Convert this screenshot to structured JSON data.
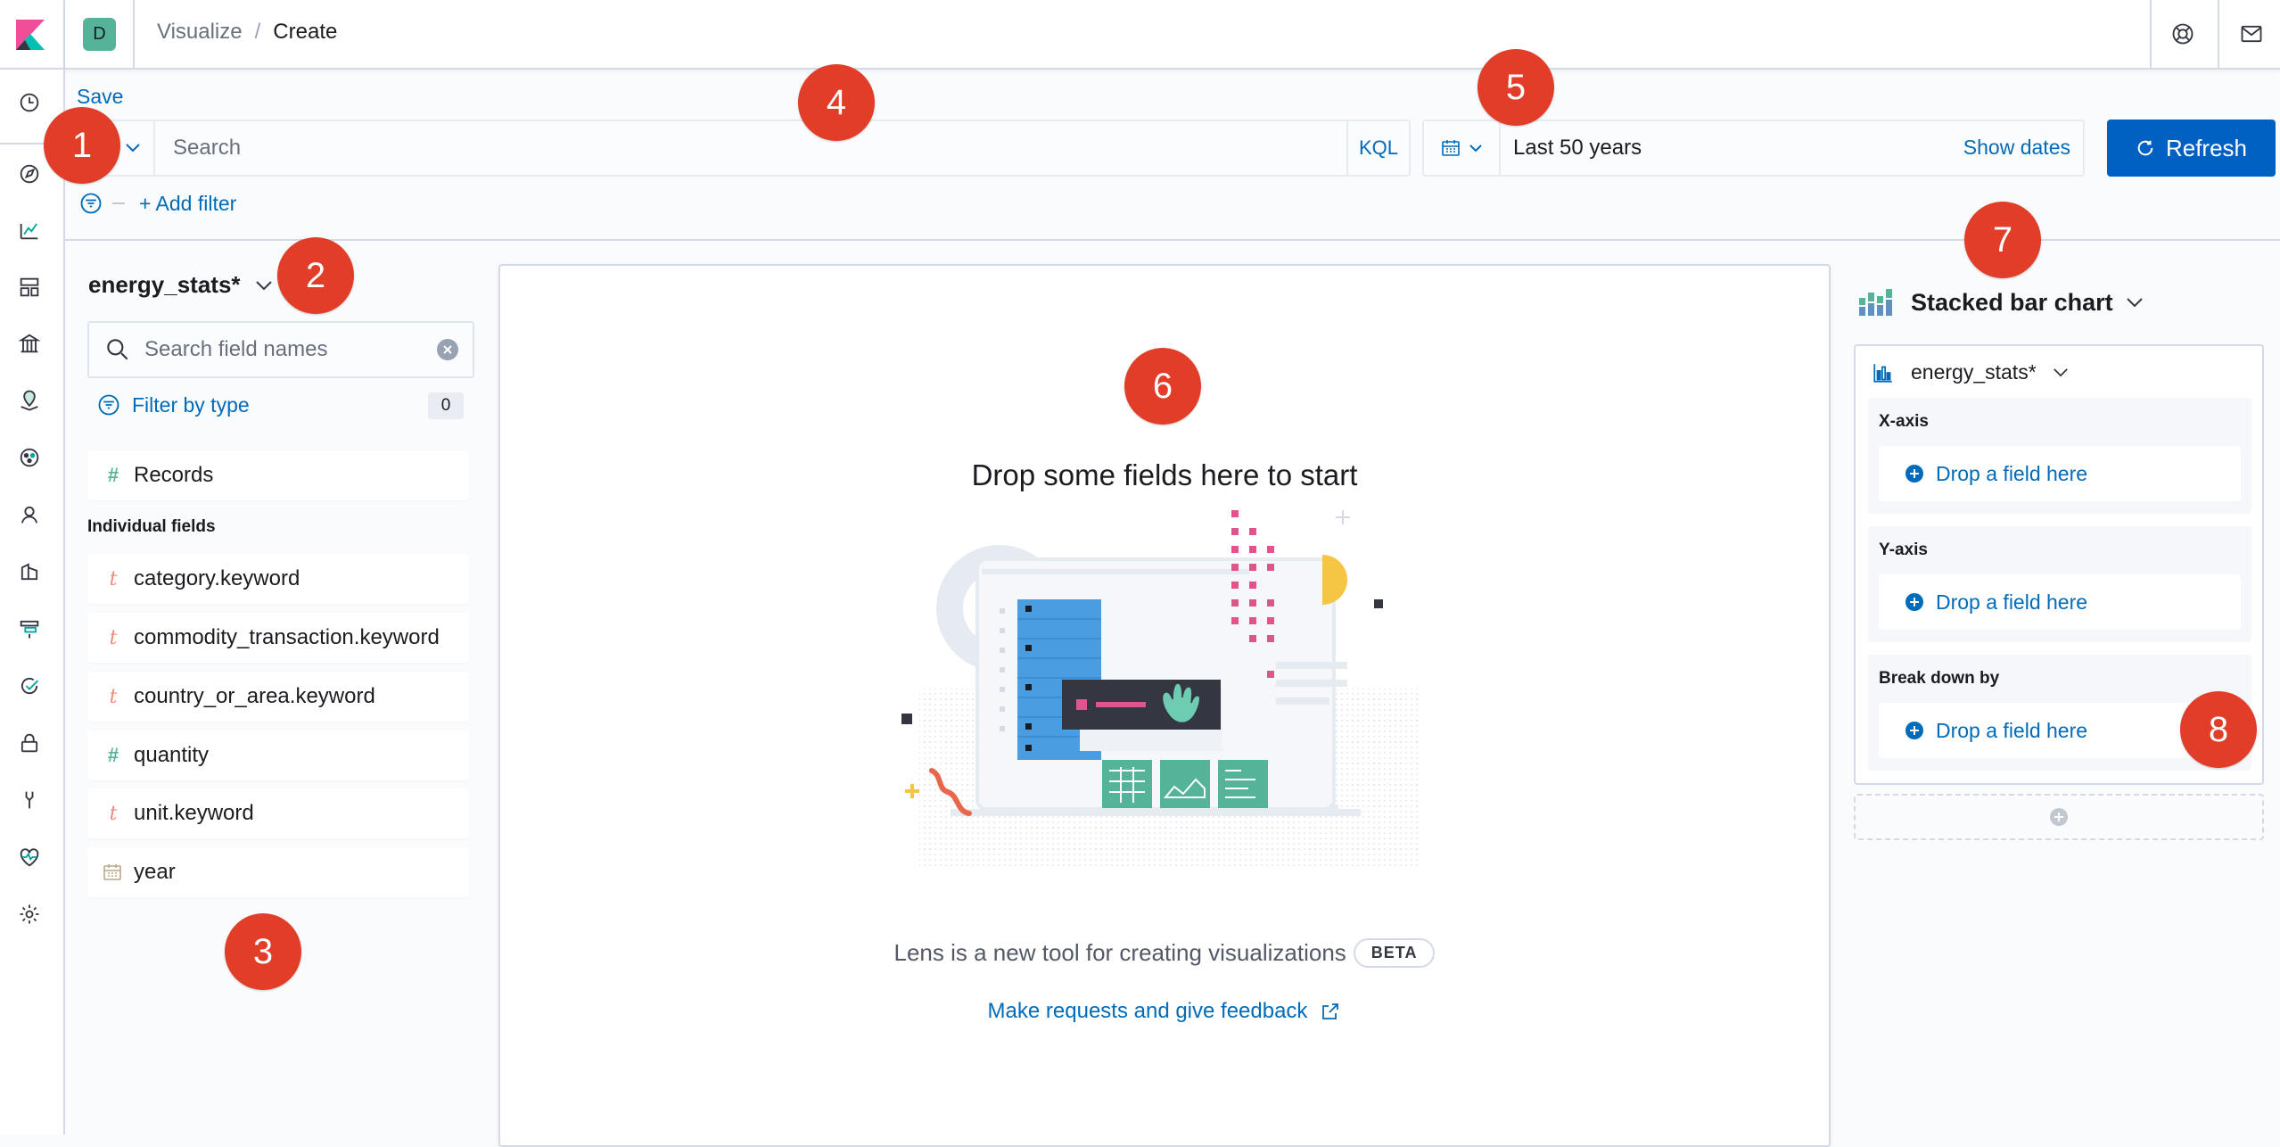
{
  "breadcrumbs": {
    "parent": "Visualize",
    "separator": "/",
    "current": "Create"
  },
  "space": {
    "initial": "D",
    "color": "#54b399"
  },
  "query": {
    "save_label": "Save",
    "search_placeholder": "Search",
    "language_label": "KQL",
    "add_filter_label": "+ Add filter"
  },
  "date_picker": {
    "value": "Last 50 years",
    "show_dates_label": "Show dates"
  },
  "refresh_label": "Refresh",
  "datasource": {
    "index_pattern": "energy_stats*",
    "search_placeholder": "Search field names",
    "filter_by_type_label": "Filter by type",
    "filter_count": "0",
    "records_label": "Records",
    "individual_fields_title": "Individual fields",
    "fields": [
      {
        "name": "category.keyword",
        "type": "string",
        "type_glyph": "t"
      },
      {
        "name": "commodity_transaction.keyword",
        "type": "string",
        "type_glyph": "t"
      },
      {
        "name": "country_or_area.keyword",
        "type": "string",
        "type_glyph": "t"
      },
      {
        "name": "quantity",
        "type": "number",
        "type_glyph": "#"
      },
      {
        "name": "unit.keyword",
        "type": "string",
        "type_glyph": "t"
      },
      {
        "name": "year",
        "type": "date",
        "type_glyph": "calendar-icon"
      }
    ]
  },
  "workspace": {
    "empty_title": "Drop some fields here to start",
    "description": "Lens is a new tool for creating visualizations",
    "beta_label": "BETA",
    "feedback_link": "Make requests and give feedback"
  },
  "config": {
    "chart_type": "Stacked bar chart",
    "layer_index": "energy_stats*",
    "x_axis_label": "X-axis",
    "y_axis_label": "Y-axis",
    "breakdown_label": "Break down by",
    "drop_label": "Drop a field here"
  },
  "callouts": [
    "1",
    "2",
    "3",
    "4",
    "5",
    "6",
    "7",
    "8"
  ],
  "colors": {
    "accent": "#006bb8",
    "primary_button": "#0061c2",
    "callout": "#e23d28"
  }
}
